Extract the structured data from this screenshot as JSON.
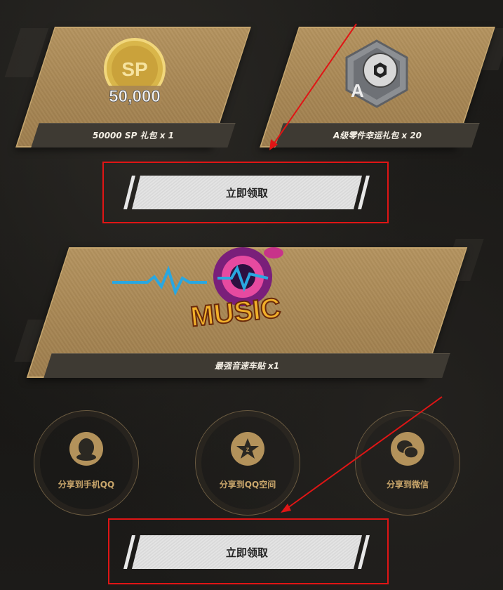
{
  "rewards": [
    {
      "caption": "50000 SP 礼包 x 1",
      "icon_text": "SP",
      "icon_amount": "50,000"
    },
    {
      "caption": "A级零件幸运礼包 x 20",
      "icon_text": "A"
    },
    {
      "caption": "最强音速车贴 x1",
      "icon_text": "MUSIC"
    }
  ],
  "claim_button_label": "立即领取",
  "share": [
    {
      "label": "分享到手机QQ",
      "icon": "qq-icon"
    },
    {
      "label": "分享到QQ空间",
      "icon": "qzone-icon"
    },
    {
      "label": "分享到微信",
      "icon": "wechat-icon"
    }
  ],
  "colors": {
    "accent_red": "#e01515",
    "card_gold": "#a78654",
    "share_gold": "#c9a66b"
  }
}
